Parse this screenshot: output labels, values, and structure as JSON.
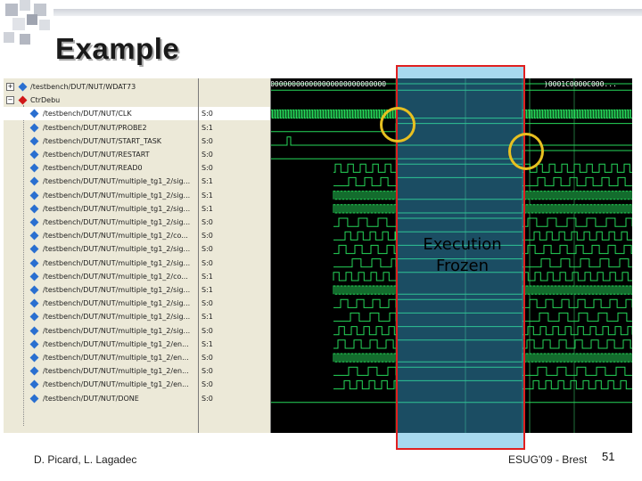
{
  "title": "Example",
  "footer": {
    "authors": "D. Picard, L. Lagadec",
    "event": "ESUG'09 - Brest",
    "page": "51"
  },
  "overlay": {
    "line1": "Execution",
    "line2": "Frozen"
  },
  "wave": {
    "bus_text_left": "0000000000000000000000000000000000000000000",
    "bus_text_right": ")0001C0000C000...",
    "signals": [
      {
        "name": "/testbench/DUT/NUT/WDAT73",
        "value": "",
        "icon": "plus-box",
        "type": "bus"
      },
      {
        "name": "CtrDebu",
        "value": "",
        "icon": "minus-box-red-diamond",
        "type": "group"
      },
      {
        "name": "/testbench/DUT/NUT/CLK",
        "value": "S:0",
        "icon": "blue-diamond",
        "type": "clock",
        "selected": true
      },
      {
        "name": "/testbench/DUT/NUT/PROBE2",
        "value": "S:1",
        "icon": "blue-diamond",
        "type": "probe"
      },
      {
        "name": "/testbench/DUT/NUT/START_TASK",
        "value": "S:0",
        "icon": "blue-diamond",
        "type": "start"
      },
      {
        "name": "/testbench/DUT/NUT/RESTART",
        "value": "S:0",
        "icon": "blue-diamond",
        "type": "restart"
      },
      {
        "name": "/testbench/DUT/NUT/READ0",
        "value": "S:0",
        "icon": "blue-diamond",
        "type": "p1"
      },
      {
        "name": "/testbench/DUT/NUT/multiple_tg1_2/sig...",
        "value": "S:1",
        "icon": "blue-diamond",
        "type": "p2"
      },
      {
        "name": "/testbench/DUT/NUT/multiple_tg1_2/sig...",
        "value": "S:1",
        "icon": "blue-diamond",
        "type": "dense"
      },
      {
        "name": "/testbench/DUT/NUT/multiple_tg1_2/sig...",
        "value": "S:1",
        "icon": "blue-diamond",
        "type": "dense"
      },
      {
        "name": "/testbench/DUT/NUT/multiple_tg1_2/sig...",
        "value": "S:0",
        "icon": "blue-diamond",
        "type": "p3"
      },
      {
        "name": "/testbench/DUT/NUT/multiple_tg1_2/co...",
        "value": "S:0",
        "icon": "blue-diamond",
        "type": "p1"
      },
      {
        "name": "/testbench/DUT/NUT/multiple_tg1_2/sig...",
        "value": "S:0",
        "icon": "blue-diamond",
        "type": "p2"
      },
      {
        "name": "/testbench/DUT/NUT/multiple_tg1_2/sig...",
        "value": "S:0",
        "icon": "blue-diamond",
        "type": "p3"
      },
      {
        "name": "/testbench/DUT/NUT/multiple_tg1_2/co...",
        "value": "S:1",
        "icon": "blue-diamond",
        "type": "p1"
      },
      {
        "name": "/testbench/DUT/NUT/multiple_tg1_2/sig...",
        "value": "S:1",
        "icon": "blue-diamond",
        "type": "dense"
      },
      {
        "name": "/testbench/DUT/NUT/multiple_tg1_2/sig...",
        "value": "S:0",
        "icon": "blue-diamond",
        "type": "p2"
      },
      {
        "name": "/testbench/DUT/NUT/multiple_tg1_2/sig...",
        "value": "S:1",
        "icon": "blue-diamond",
        "type": "p3"
      },
      {
        "name": "/testbench/DUT/NUT/multiple_tg1_2/sig...",
        "value": "S:0",
        "icon": "blue-diamond",
        "type": "p1"
      },
      {
        "name": "/testbench/DUT/NUT/multiple_tg1_2/en...",
        "value": "S:1",
        "icon": "blue-diamond",
        "type": "p2"
      },
      {
        "name": "/testbench/DUT/NUT/multiple_tg1_2/en...",
        "value": "S:0",
        "icon": "blue-diamond",
        "type": "dense"
      },
      {
        "name": "/testbench/DUT/NUT/multiple_tg1_2/en...",
        "value": "S:0",
        "icon": "blue-diamond",
        "type": "p3"
      },
      {
        "name": "/testbench/DUT/NUT/multiple_tg1_2/en...",
        "value": "S:0",
        "icon": "blue-diamond",
        "type": "p1"
      },
      {
        "name": "/testbench/DUT/NUT/DONE",
        "value": "S:0",
        "icon": "blue-diamond",
        "type": "done"
      }
    ]
  }
}
